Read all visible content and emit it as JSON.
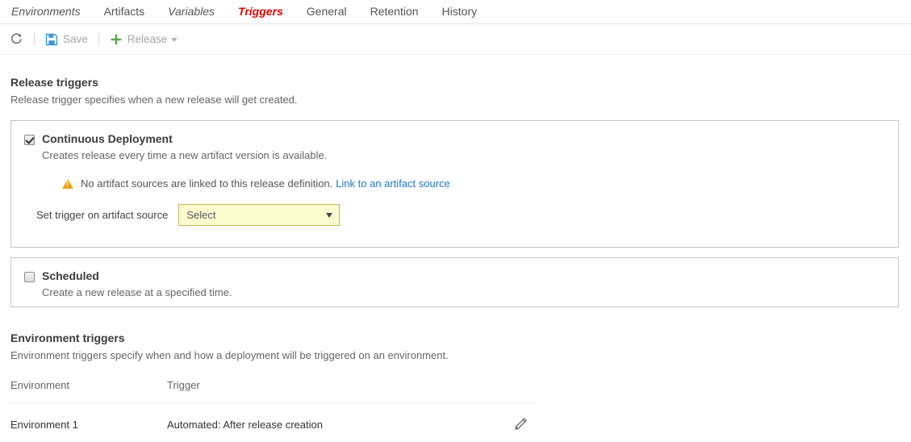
{
  "tabs": [
    {
      "label": "Environments",
      "active": false,
      "italic": true
    },
    {
      "label": "Artifacts",
      "active": false,
      "italic": false
    },
    {
      "label": "Variables",
      "active": false,
      "italic": true
    },
    {
      "label": "Triggers",
      "active": true,
      "italic": true
    },
    {
      "label": "General",
      "active": false,
      "italic": false
    },
    {
      "label": "Retention",
      "active": false,
      "italic": false
    },
    {
      "label": "History",
      "active": false,
      "italic": false
    }
  ],
  "toolbar": {
    "refresh_icon": "refresh-icon",
    "save_label": "Save",
    "save_icon": "save-floppy-icon",
    "release_label": "Release",
    "release_icon": "plus-icon",
    "release_caret": "chevron-down-icon"
  },
  "release_triggers": {
    "title": "Release triggers",
    "description": "Release trigger specifies when a new release will get created.",
    "continuous_deployment": {
      "checked": true,
      "title": "Continuous Deployment",
      "description": "Creates release every time a new artifact version is available.",
      "warning": {
        "icon": "warning-triangle-icon",
        "text": "No artifact sources are linked to this release definition.",
        "link_label": "Link to an artifact source"
      },
      "field": {
        "label": "Set trigger on artifact source",
        "value": "Select"
      }
    },
    "scheduled": {
      "checked": false,
      "title": "Scheduled",
      "description": "Create a new release at a specified time."
    }
  },
  "environment_triggers": {
    "title": "Environment triggers",
    "description": "Environment triggers specify when and how a deployment will be triggered on an environment.",
    "columns": [
      "Environment",
      "Trigger"
    ],
    "rows": [
      {
        "environment": "Environment 1",
        "trigger": "Automated: After release creation",
        "action_icon": "pencil-edit-icon"
      }
    ]
  },
  "colors": {
    "accent_red": "#e60000",
    "link_blue": "#2277cc",
    "warning_orange": "#f2a21c",
    "select_bg": "#fbfbcf",
    "select_border": "#c9b758",
    "save_blue": "#3a96dd",
    "plus_green": "#57a64a"
  }
}
